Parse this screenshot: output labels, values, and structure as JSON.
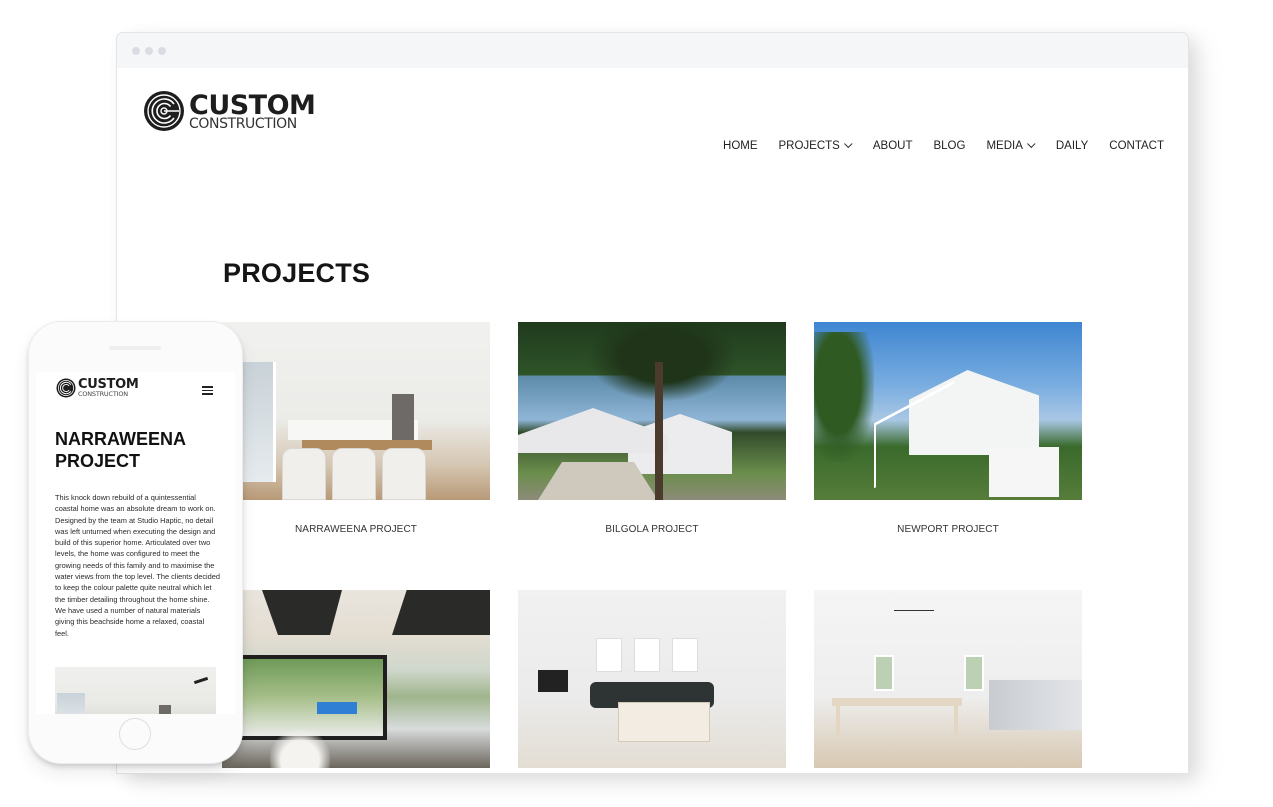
{
  "browser": {
    "window_controls": [
      "dot",
      "dot",
      "dot"
    ]
  },
  "site": {
    "logo": {
      "primary": "CUSTOM",
      "secondary": "CONSTRUCTION",
      "icon": "concentric-c-logo-icon"
    },
    "nav": [
      {
        "label": "HOME",
        "has_dropdown": false
      },
      {
        "label": "PROJECTS",
        "has_dropdown": true
      },
      {
        "label": "ABOUT",
        "has_dropdown": false
      },
      {
        "label": "BLOG",
        "has_dropdown": false
      },
      {
        "label": "MEDIA",
        "has_dropdown": true
      },
      {
        "label": "DAILY",
        "has_dropdown": false
      },
      {
        "label": "CONTACT",
        "has_dropdown": false
      }
    ],
    "page_title": "PROJECTS",
    "projects": [
      {
        "caption": "NARRAWEENA PROJECT",
        "image": "white kitchen and dining interior"
      },
      {
        "caption": "BILGOLA PROJECT",
        "image": "coastal house with palm trees"
      },
      {
        "caption": "NEWPORT PROJECT",
        "image": "white two-storey house with stairs"
      },
      {
        "caption": "",
        "image": "living room opening to pool"
      },
      {
        "caption": "",
        "image": "white lounge room with dark sofa"
      },
      {
        "caption": "",
        "image": "white dining room and kitchen"
      }
    ]
  },
  "mobile": {
    "logo": {
      "primary": "CUSTOM",
      "secondary": "CONSTRUCTION"
    },
    "menu_icon": "hamburger-icon",
    "title": "NARRAWEENA PROJECT",
    "body": "This knock down rebuild of a quintessential coastal home was an absolute dream to work on. Designed by the team at Studio Haptic, no detail was left unturned when executing the design and build of this superior home. Articulated over two levels, the home was configured to meet the growing needs of this family and to maximise the water views from the top level. The clients decided to keep the colour palette quite neutral which let the timber detailing throughout the home shine. We have used a number of natural materials giving this beachside home a relaxed, coastal feel."
  },
  "colors": {
    "text": "#222222",
    "browser_bar": "#f5f6f8",
    "window_dot": "#d9dde3"
  }
}
